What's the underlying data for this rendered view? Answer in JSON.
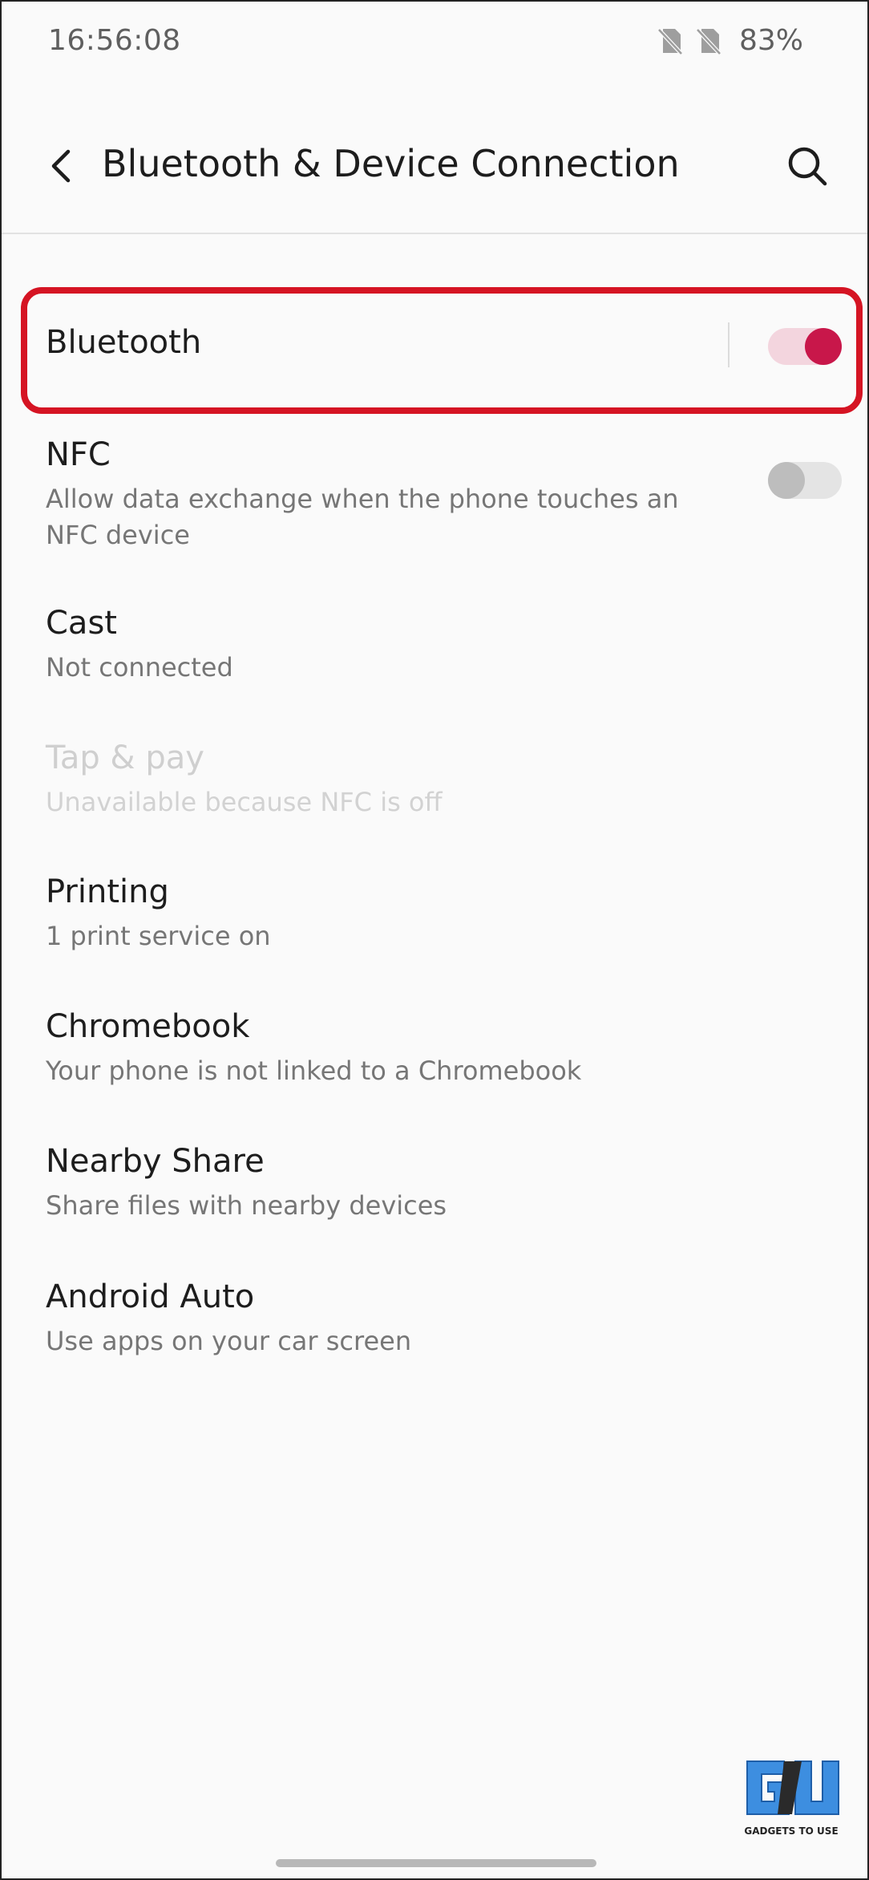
{
  "status_bar": {
    "time": "16:56:08",
    "battery": "83%",
    "icons": [
      "no-sim-icon",
      "no-sim-icon"
    ]
  },
  "app_bar": {
    "title": "Bluetooth & Device Connection",
    "back_icon": "back-arrow-icon",
    "search_icon": "search-icon"
  },
  "settings": {
    "bluetooth": {
      "title": "Bluetooth",
      "enabled": true
    },
    "nfc": {
      "title": "NFC",
      "summary": "Allow data exchange when the phone touches an NFC device",
      "enabled": false
    },
    "cast": {
      "title": "Cast",
      "summary": "Not connected"
    },
    "tap_pay": {
      "title": "Tap & pay",
      "summary": "Unavailable because NFC is off",
      "disabled": true
    },
    "printing": {
      "title": "Printing",
      "summary": "1 print service on"
    },
    "chromebook": {
      "title": "Chromebook",
      "summary": "Your phone is not linked to a Chromebook"
    },
    "nearby_share": {
      "title": "Nearby Share",
      "summary": "Share files with nearby devices"
    },
    "android_auto": {
      "title": "Android Auto",
      "summary": "Use apps on your car screen"
    }
  },
  "watermark": {
    "caption": "GADGETS TO USE"
  },
  "colors": {
    "accent": "#c8174a",
    "highlight": "#d51423",
    "background": "#fafafa"
  }
}
